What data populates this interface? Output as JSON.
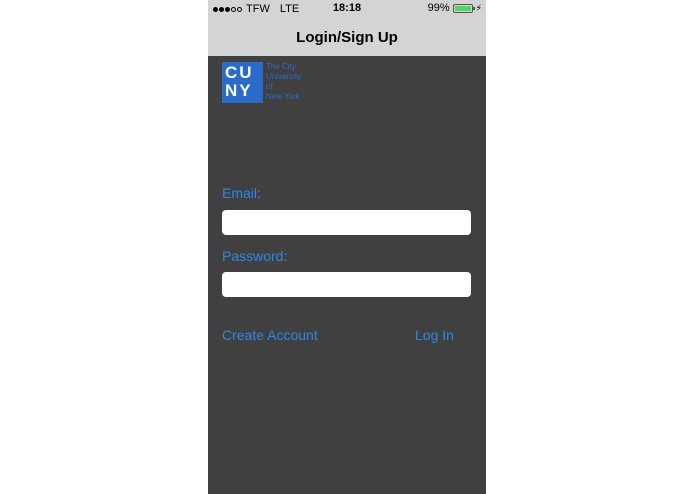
{
  "status_bar": {
    "carrier": "TFW",
    "network": "LTE",
    "time": "18:18",
    "battery_percent": "99%",
    "battery_level": 0.99,
    "battery_color": "#4cd964",
    "signal_bars_filled": 3,
    "signal_bars_total": 5
  },
  "nav": {
    "title": "Login/Sign Up"
  },
  "logo": {
    "mark_line1": "CU",
    "mark_line2": "NY",
    "text_line1": "The City",
    "text_line2": "University",
    "text_line3": "of",
    "text_line4": "New York",
    "color": "#2b6bc9"
  },
  "form": {
    "email_label": "Email:",
    "email_value": "",
    "password_label": "Password:",
    "password_value": ""
  },
  "actions": {
    "create_account_label": "Create Account",
    "login_label": "Log In"
  },
  "colors": {
    "background": "#404040",
    "bar": "#d4d4d4",
    "accent": "#2e86e6"
  }
}
